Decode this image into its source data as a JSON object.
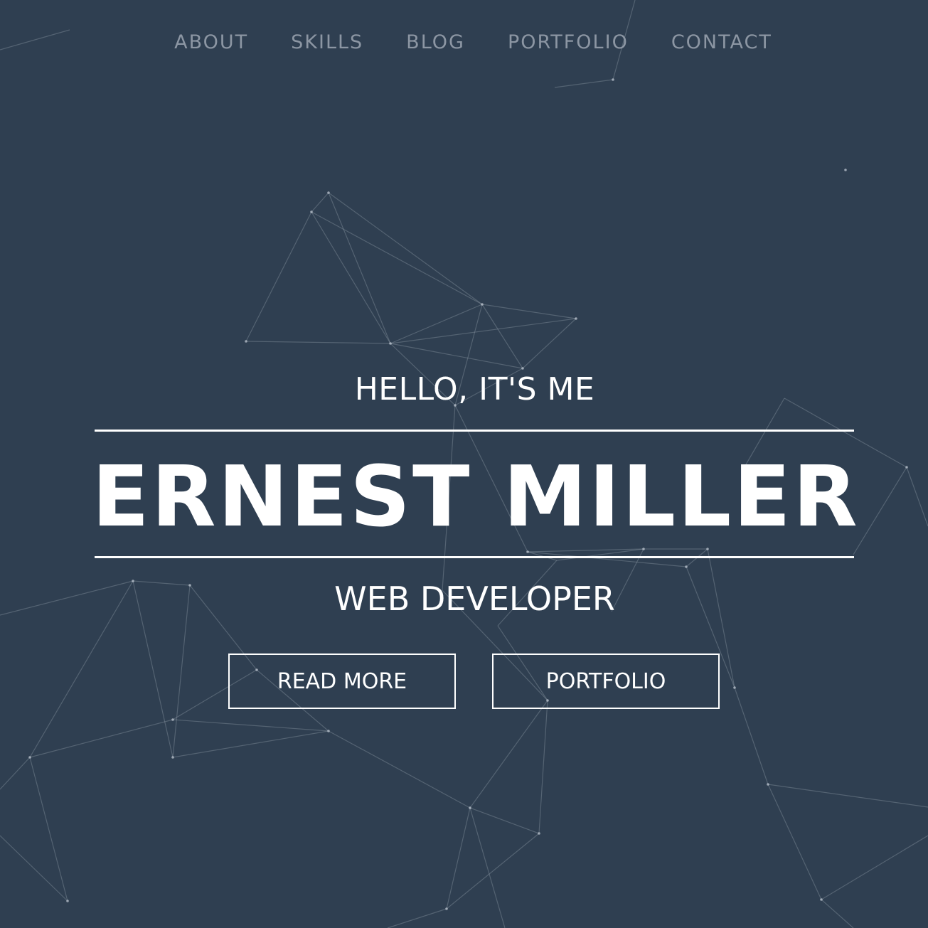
{
  "nav": {
    "items": [
      {
        "label": "ABOUT"
      },
      {
        "label": "SKILLS"
      },
      {
        "label": "BLOG"
      },
      {
        "label": "PORTFOLIO"
      },
      {
        "label": "CONTACT"
      }
    ]
  },
  "hero": {
    "greeting": "HELLO, IT'S ME",
    "name": "ERNEST MILLER",
    "role": "WEB DEVELOPER",
    "buttons": {
      "read_more": "READ MORE",
      "portfolio": "PORTFOLIO"
    }
  },
  "colors": {
    "background": "#2f3f51",
    "text": "#ffffff",
    "nav_text": "#8c96a3",
    "network_lines": "#9aa6b3"
  }
}
